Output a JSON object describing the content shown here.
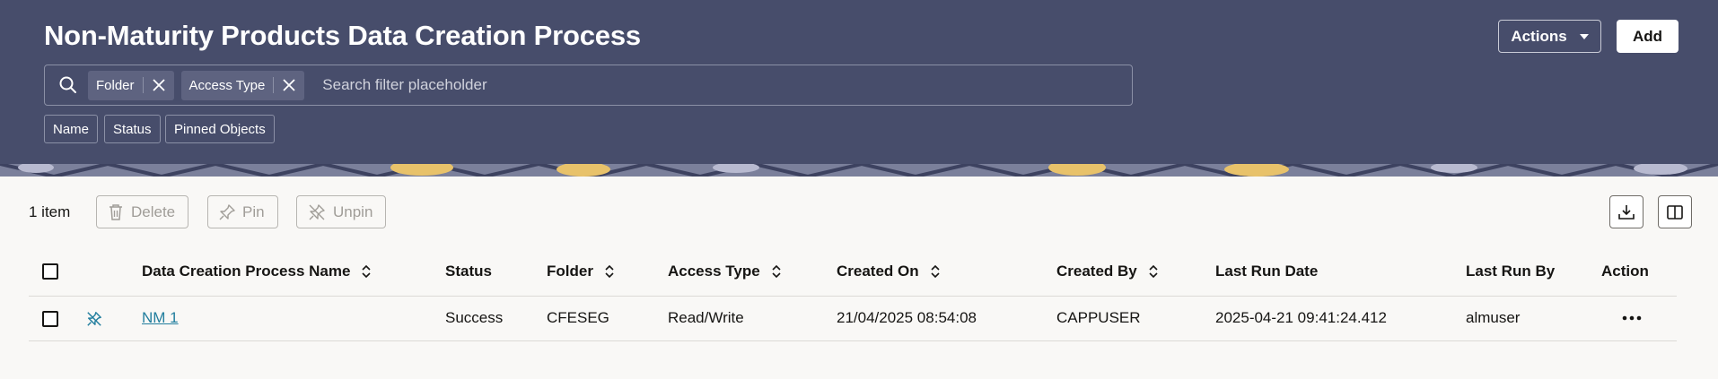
{
  "header": {
    "title": "Non-Maturity Products Data Creation Process",
    "actions_label": "Actions",
    "add_label": "Add"
  },
  "search": {
    "placeholder": "Search filter placeholder",
    "chips": [
      {
        "label": "Folder"
      },
      {
        "label": "Access Type"
      }
    ],
    "filter_options": [
      "Name",
      "Status",
      "Pinned Objects"
    ]
  },
  "toolbar": {
    "count": "1 item",
    "delete_label": "Delete",
    "pin_label": "Pin",
    "unpin_label": "Unpin"
  },
  "table": {
    "columns": [
      "Data Creation Process Name",
      "Status",
      "Folder",
      "Access Type",
      "Created On",
      "Created By",
      "Last Run Date",
      "Last Run By",
      "Action"
    ],
    "rows": [
      {
        "name": "NM 1",
        "status": "Success",
        "folder": "CFESEG",
        "access_type": "Read/Write",
        "created_on": "21/04/2025 08:54:08",
        "created_by": "CAPPUSER",
        "last_run_date": "2025-04-21 09:41:24.412",
        "last_run_by": "almuser"
      }
    ]
  },
  "colors": {
    "header_bg": "#474d6b",
    "link": "#227e9e",
    "page_bg": "#f9f8f6"
  }
}
